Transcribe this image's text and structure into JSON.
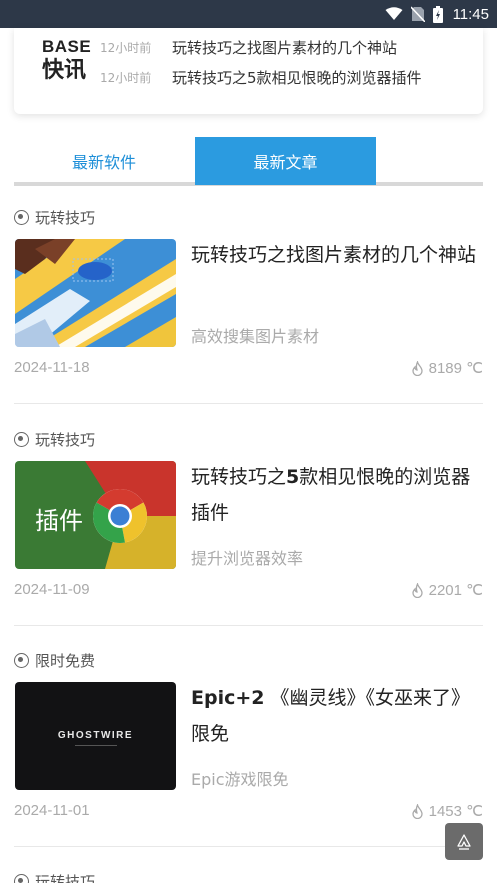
{
  "status_bar": {
    "time": "11:45"
  },
  "news_flash": {
    "logo_top": "BASE",
    "logo_bottom": "快讯",
    "items": [
      {
        "time": "12小时前",
        "text": "玩转技巧之找图片素材的几个神站"
      },
      {
        "time": "12小时前",
        "text": "玩转技巧之5款相见恨晚的浏览器插件"
      }
    ]
  },
  "tabs": [
    {
      "label": "最新软件",
      "active": false
    },
    {
      "label": "最新文章",
      "active": true
    }
  ],
  "articles": [
    {
      "category": "玩转技巧",
      "title": "玩转技巧之找图片素材的几个神站",
      "subtitle": "高效搜集图片素材",
      "date": "2024-11-18",
      "heat": "8189 ℃"
    },
    {
      "category": "玩转技巧",
      "title_prefix": "玩转技巧之",
      "title_bold": "5",
      "title_suffix": "款相见恨晚的浏览器插件",
      "subtitle": "提升浏览器效率",
      "date": "2024-11-09",
      "heat": "2201 ℃",
      "thumb_text": "插件"
    },
    {
      "category": "限时免费",
      "title_bold": "Epic+2",
      "title_suffix": " 《幽灵线》《女巫来了》限免",
      "subtitle": "Epic游戏限免",
      "date": "2024-11-01",
      "heat": "1453 ℃",
      "thumb_text": "GHOSTWIRE"
    },
    {
      "category": "玩转技巧"
    }
  ],
  "colors": {
    "accent": "#2b9be0",
    "status_bar": "#2d3848"
  }
}
